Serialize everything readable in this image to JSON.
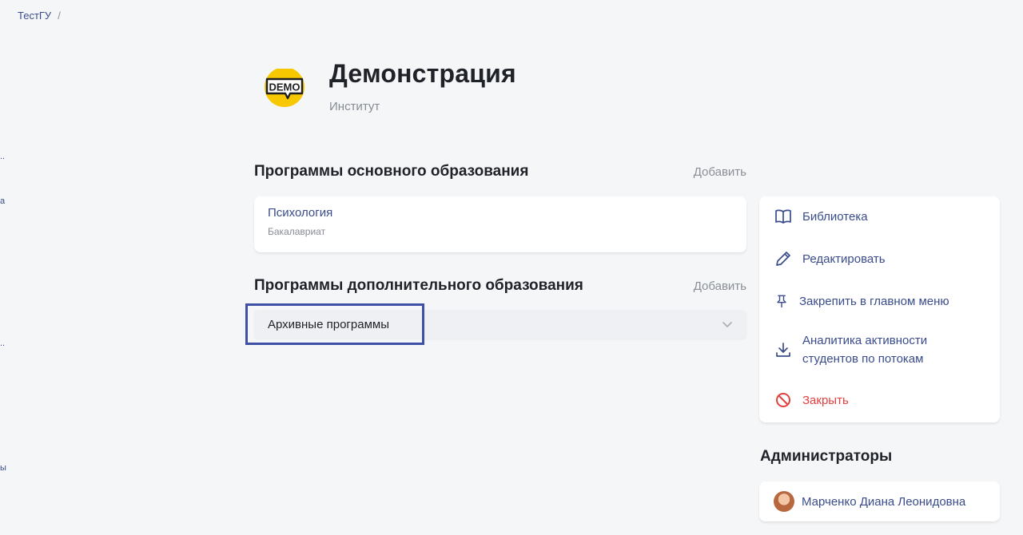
{
  "breadcrumb": {
    "root": "ТестГУ",
    "separator": "/"
  },
  "sidebar_fragments": [
    "..",
    "a",
    "..",
    "ы"
  ],
  "header": {
    "logo_text": "DEMO",
    "title": "Демонстрация",
    "subtitle": "Институт"
  },
  "main_programs": {
    "heading": "Программы основного образования",
    "add_label": "Добавить",
    "items": [
      {
        "name": "Психология",
        "level": "Бакалавриат"
      }
    ]
  },
  "extra_programs": {
    "heading": "Программы дополнительного образования",
    "add_label": "Добавить",
    "archive_label": "Архивные программы"
  },
  "actions": {
    "library": "Библиотека",
    "edit": "Редактировать",
    "pin": "Закрепить в главном меню",
    "analytics_line1": "Аналитика активности",
    "analytics_line2": "студентов по потокам",
    "close": "Закрыть"
  },
  "admins": {
    "heading": "Администраторы",
    "items": [
      {
        "name": "Марченко Диана Леонидовна"
      }
    ]
  },
  "colors": {
    "accent": "#3a4c8c",
    "danger": "#e0413f",
    "highlight": "#3e4fa6",
    "logo_yellow": "#f7c800"
  }
}
